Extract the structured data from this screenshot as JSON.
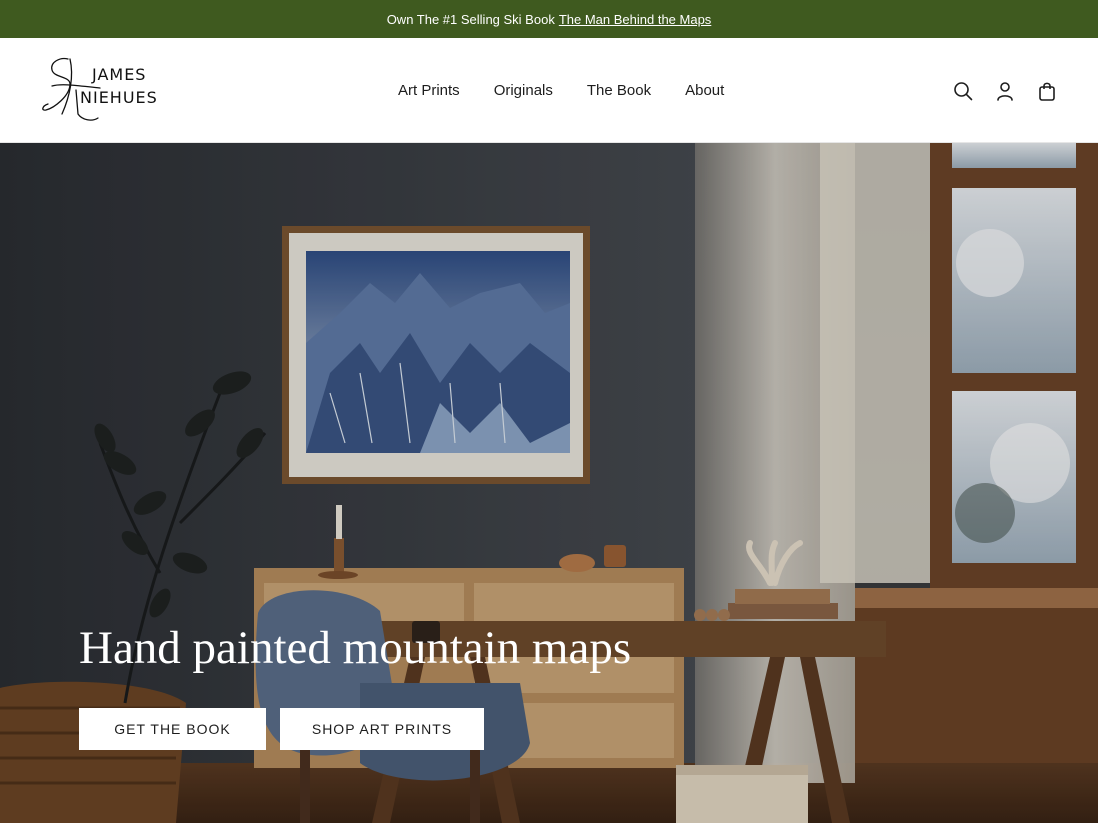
{
  "announcement": {
    "text": "Own The #1 Selling Ski Book",
    "link": "The Man Behind the Maps"
  },
  "brand": {
    "line1": "JAMES",
    "line2": "NIEHUES"
  },
  "nav": {
    "items": [
      {
        "label": "Art Prints"
      },
      {
        "label": "Originals"
      },
      {
        "label": "The Book"
      },
      {
        "label": "About"
      }
    ]
  },
  "header_icons": [
    "search-icon",
    "account-icon",
    "cart-icon"
  ],
  "hero": {
    "title": "Hand painted mountain maps",
    "primary_button": "GET THE BOOK",
    "secondary_button": "SHOP ART PRINTS"
  },
  "colors": {
    "announcement_bg": "#3f5a1f",
    "text": "#1d1d1d",
    "button_bg": "#ffffff"
  }
}
